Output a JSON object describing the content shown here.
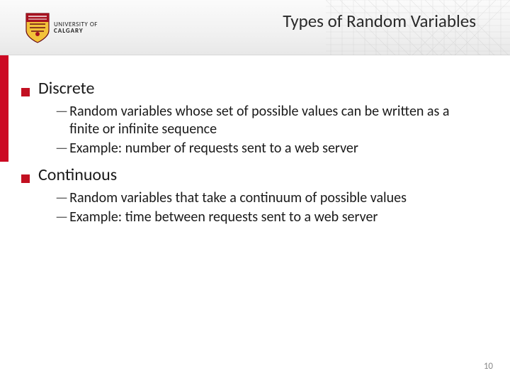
{
  "header": {
    "title": "Types of Random Variables",
    "logo": {
      "line1": "UNIVERSITY OF",
      "line2": "CALGARY"
    }
  },
  "content": {
    "items": [
      {
        "label": "Discrete",
        "subitems": [
          "Random variables whose set of possible values can be written as a finite or infinite sequence",
          "Example: number of requests sent to a web server"
        ]
      },
      {
        "label": "Continuous",
        "subitems": [
          "Random variables that take a continuum of possible values",
          "Example: time between requests sent to a web server"
        ]
      }
    ]
  },
  "page_number": "10"
}
